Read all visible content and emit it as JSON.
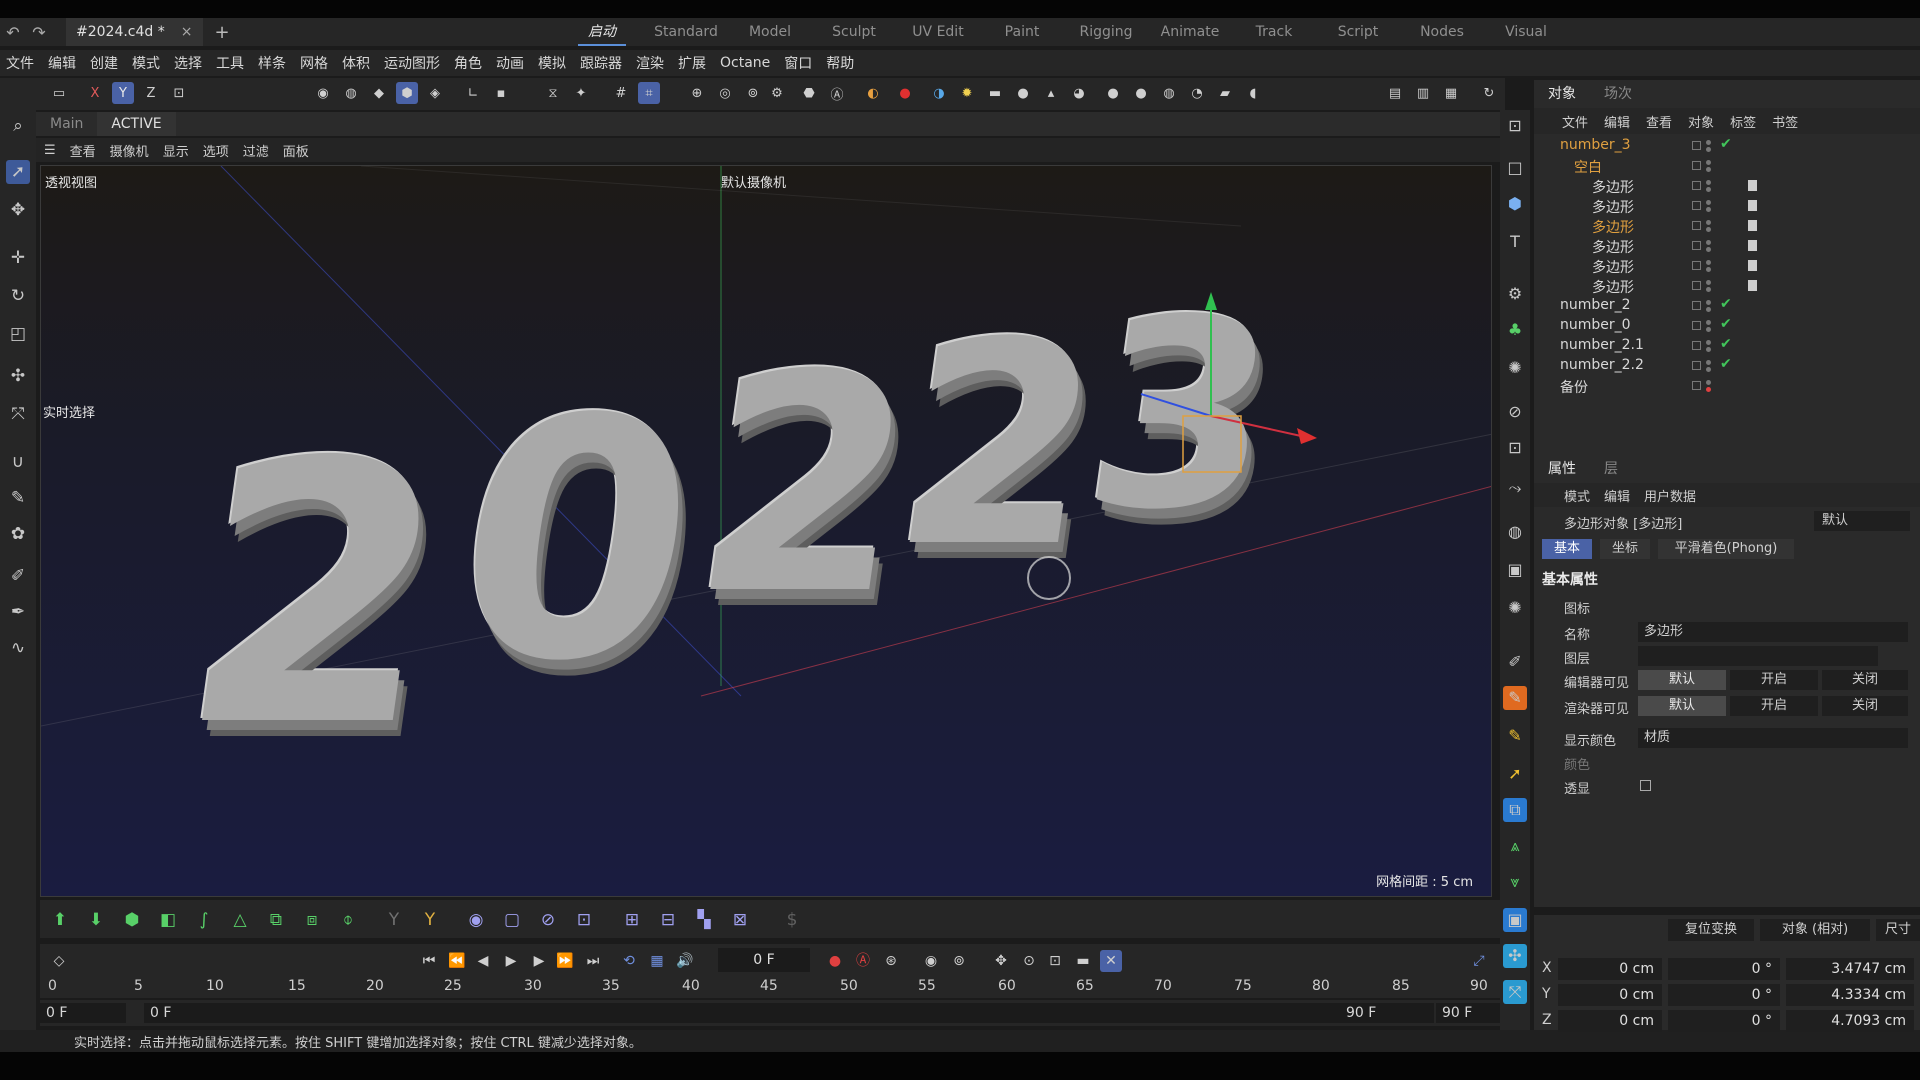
{
  "tabs": {
    "document": "#2024.c4d *",
    "close_symbol": "×",
    "new_symbol": "+",
    "layouts": [
      "启动",
      "Standard",
      "Model",
      "Sculpt",
      "UV Edit",
      "Paint",
      "Rigging",
      "Animate",
      "Track",
      "Script",
      "Nodes",
      "Visual"
    ]
  },
  "menu": [
    "文件",
    "编辑",
    "创建",
    "模式",
    "选择",
    "工具",
    "样条",
    "网格",
    "体积",
    "运动图形",
    "角色",
    "动画",
    "模拟",
    "跟踪器",
    "渲染",
    "扩展",
    "Octane",
    "窗口",
    "帮助"
  ],
  "toolbar": {
    "x": "X",
    "y": "Y",
    "z": "Z"
  },
  "viewport_tabs": [
    "Main",
    "ACTIVE"
  ],
  "viewport_menu": [
    "查看",
    "摄像机",
    "显示",
    "选项",
    "过滤",
    "面板"
  ],
  "viewport": {
    "view_name": "透视视图",
    "camera": "默认摄像机",
    "realtime": "实时选择",
    "grid_spacing": "网格间距 : 5 cm",
    "digits": [
      "2",
      "0",
      "2",
      "2",
      "3"
    ]
  },
  "timeline": {
    "current_frame": "0 F",
    "ticks": [
      "0",
      "5",
      "10",
      "15",
      "20",
      "25",
      "30",
      "35",
      "40",
      "45",
      "50",
      "55",
      "60",
      "65",
      "70",
      "75",
      "80",
      "85",
      "90"
    ],
    "range_start": "0 F",
    "range_start2": "0 F",
    "range_end": "90 F",
    "range_end2": "90 F"
  },
  "status": "实时选择：点击并拖动鼠标选择元素。按住 SHIFT 键增加选择对象；按住 CTRL 键减少选择对象。",
  "objects_panel": {
    "tabs": [
      "对象",
      "场次"
    ],
    "menu": [
      "文件",
      "编辑",
      "查看",
      "对象",
      "标签",
      "书签"
    ],
    "items": [
      {
        "name": "number_3",
        "color": "#e0a040"
      },
      {
        "name": "空白",
        "color": "#e0a040"
      },
      {
        "name": "多边形",
        "color": "#d8d8d8"
      },
      {
        "name": "多边形",
        "color": "#d8d8d8"
      },
      {
        "name": "多边形",
        "color": "#e0a040"
      },
      {
        "name": "多边形",
        "color": "#d8d8d8"
      },
      {
        "name": "多边形",
        "color": "#d8d8d8"
      },
      {
        "name": "多边形",
        "color": "#d8d8d8"
      },
      {
        "name": "number_2",
        "color": "#d8d8d8"
      },
      {
        "name": "number_0",
        "color": "#d8d8d8"
      },
      {
        "name": "number_2.1",
        "color": "#d8d8d8"
      },
      {
        "name": "number_2.2",
        "color": "#d8d8d8"
      },
      {
        "name": "备份",
        "color": "#d8d8d8"
      }
    ],
    "check_symbol": "✔"
  },
  "attributes": {
    "tabs": [
      "属性",
      "层"
    ],
    "menu": [
      "模式",
      "编辑",
      "用户数据"
    ],
    "object_title": "多边形对象 [多边形]",
    "mode": "默认",
    "subtabs": [
      "基本",
      "坐标",
      "平滑着色(Phong)"
    ],
    "section": "基本属性",
    "icon_row": "图标",
    "name_label": "名称",
    "name_value": "多边形",
    "layer_label": "图层",
    "editor_visible": "编辑器可见",
    "render_visible": "渲染器可见",
    "seg_default": "默认",
    "seg_on": "开启",
    "seg_off": "关闭",
    "display_color": "显示颜色",
    "display_color_value": "材质",
    "color_label": "颜色",
    "xray_label": "透显"
  },
  "coordinates": {
    "reset": "复位变换",
    "object_rel": "对象 (相对)",
    "size": "尺寸",
    "rows": [
      {
        "axis": "X",
        "pos": "0 cm",
        "rot": "0 °",
        "size": "3.4747 cm"
      },
      {
        "axis": "Y",
        "pos": "0 cm",
        "rot": "0 °",
        "size": "4.3334 cm"
      },
      {
        "axis": "Z",
        "pos": "0 cm",
        "rot": "0 °",
        "size": "4.7093 cm"
      }
    ]
  },
  "colors": {
    "accent": "#4a62a6",
    "check": "#41c45a",
    "highlight": "#e0a040"
  }
}
